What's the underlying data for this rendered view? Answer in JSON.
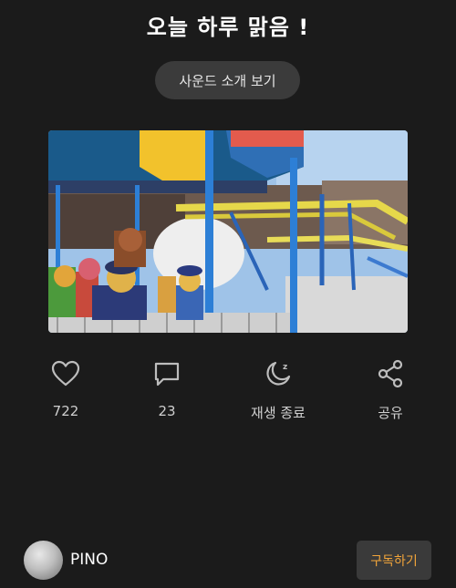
{
  "header": {
    "title": "오늘 하루 맑음 !"
  },
  "sound_button": {
    "label": "사운드 소개 보기"
  },
  "photo": {
    "description_icon": "amusement-park-photo"
  },
  "actions": {
    "like": {
      "count": "722",
      "icon": "heart-icon"
    },
    "comment": {
      "count": "23",
      "icon": "comment-icon"
    },
    "sleep_timer": {
      "label": "재생 종료",
      "icon": "moon-icon"
    },
    "share": {
      "label": "공유",
      "icon": "share-icon"
    }
  },
  "footer": {
    "username": "PINO",
    "subscribe_label": "구독하기"
  },
  "colors": {
    "background": "#1b1b1b",
    "button_bg": "#3b3b3b",
    "accent_orange": "#f2a53a",
    "text_muted": "#cfcfcf"
  }
}
